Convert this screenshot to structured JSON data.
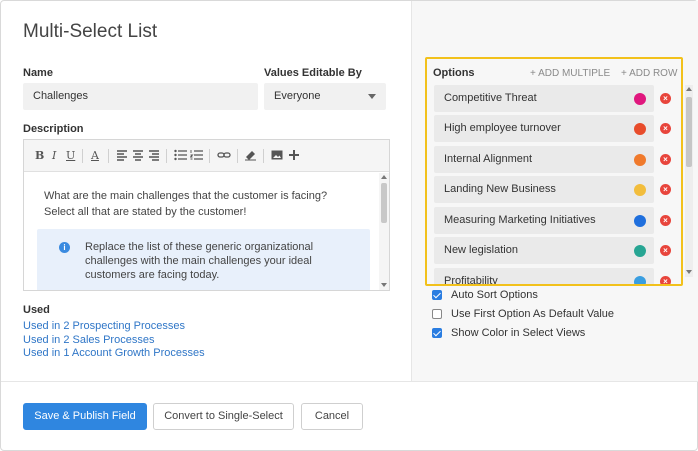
{
  "dialog": {
    "title": "Multi-Select List"
  },
  "name_field": {
    "label": "Name",
    "value": "Challenges"
  },
  "editable_by": {
    "label": "Values Editable By",
    "value": "Everyone"
  },
  "description": {
    "label": "Description",
    "toolbar": {
      "bold": "B",
      "italic": "I",
      "underline": "U",
      "text_color": "A"
    },
    "text": "What are the main challenges that the customer is facing? Select all that are stated by the customer!",
    "info_icon": "i",
    "info_text": "Replace the list of these generic organizational challenges with the main challenges your ideal customers are facing today."
  },
  "used": {
    "label": "Used",
    "links": [
      "Used in 2 Prospecting Processes",
      "Used in 2 Sales Processes",
      "Used in 1 Account Growth Processes"
    ]
  },
  "options": {
    "header": "Options",
    "add_multiple": "+ ADD MULTIPLE",
    "add_row": "+ ADD ROW",
    "delete_icon": "×",
    "items": [
      {
        "label": "Competitive Threat",
        "color": "#e0177e"
      },
      {
        "label": "High employee turnover",
        "color": "#e84c2b"
      },
      {
        "label": "Internal Alignment",
        "color": "#f07a2c"
      },
      {
        "label": "Landing New Business",
        "color": "#f2bd3c"
      },
      {
        "label": "Measuring Marketing Initiatives",
        "color": "#1f6fdd"
      },
      {
        "label": "New legislation",
        "color": "#27a593"
      },
      {
        "label": "Profitability",
        "color": "#3a9ee0"
      }
    ]
  },
  "settings": {
    "auto_sort": {
      "label": "Auto Sort Options",
      "checked": true
    },
    "first_default": {
      "label": "Use First Option As Default Value",
      "checked": false
    },
    "show_color": {
      "label": "Show Color in Select Views",
      "checked": true
    }
  },
  "footer": {
    "save_label": "Save & Publish Field",
    "convert_label": "Convert to Single-Select",
    "cancel_label": "Cancel"
  },
  "colors": {
    "accent": "#2f86e0",
    "highlight": "#f2c11b",
    "delete": "#e8453c",
    "link": "#2f76c7"
  }
}
